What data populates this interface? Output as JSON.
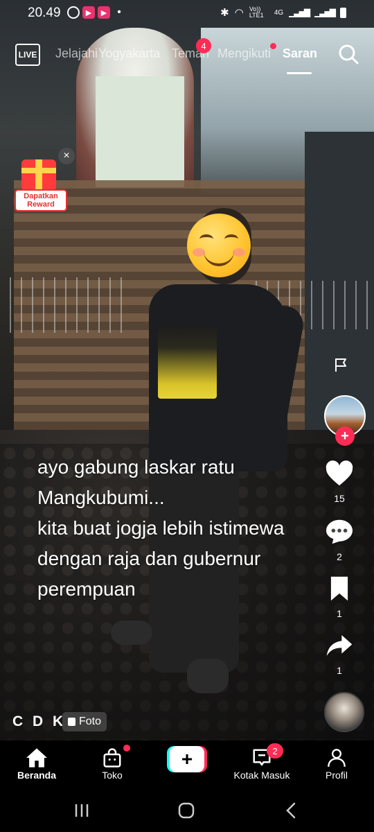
{
  "status_bar": {
    "time": "20.49",
    "network": "4G",
    "volte": "Vo)) LTE1"
  },
  "top_nav": {
    "tabs": [
      "Jelajahi",
      "Yogyakarta",
      "Teman",
      "Mengikuti",
      "Saran"
    ],
    "active_tab": "Saran",
    "friends_badge": "4",
    "live_label": "LIVE"
  },
  "reward": {
    "label": "Dapatkan Reward"
  },
  "post": {
    "caption": "ayo gabung laskar ratu\nMangkubumi...\nkita buat jogja lebih istimewa\ndengan raja dan gubernur\nperempuan",
    "author": "C D K",
    "type_badge": "Foto"
  },
  "actions": {
    "likes": "15",
    "comments": "2",
    "bookmarks": "1",
    "shares": "1"
  },
  "bottom_nav": {
    "home": "Beranda",
    "shop": "Toko",
    "inbox": "Kotak Masuk",
    "inbox_badge": "2",
    "profile": "Profil"
  },
  "colors": {
    "accent": "#fe2c55",
    "cyan": "#25f4ee"
  }
}
